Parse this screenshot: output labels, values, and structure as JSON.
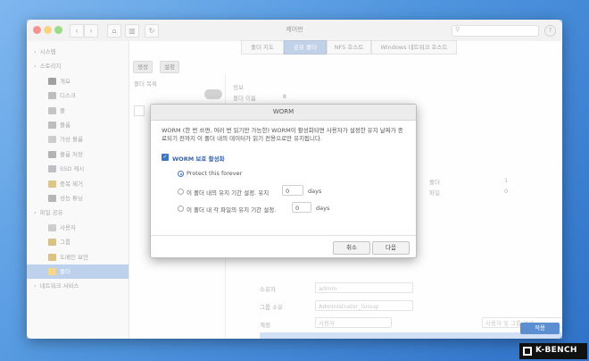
{
  "window": {
    "title": "제어판"
  },
  "tabs": [
    {
      "label": "폴더 지도"
    },
    {
      "label": "공유 폴더"
    },
    {
      "label": "NFS 호스트"
    },
    {
      "label": "Windows 네트워크 호스트"
    }
  ],
  "sidebar": {
    "items": [
      {
        "label": "시스템",
        "level": 0
      },
      {
        "label": "스토리지",
        "level": 0
      },
      {
        "label": "개요",
        "level": 1
      },
      {
        "label": "디스크",
        "level": 1
      },
      {
        "label": "풀",
        "level": 1
      },
      {
        "label": "볼륨",
        "level": 1
      },
      {
        "label": "가상 볼륨",
        "level": 1
      },
      {
        "label": "볼륨 저장",
        "level": 1
      },
      {
        "label": "SSD 캐시",
        "level": 1
      },
      {
        "label": "중복 제거",
        "level": 1
      },
      {
        "label": "성능 튜닝",
        "level": 1
      },
      {
        "label": "파일 공유",
        "level": 0
      },
      {
        "label": "사용자",
        "level": 1
      },
      {
        "label": "그룹",
        "level": 1
      },
      {
        "label": "도메인 보안",
        "level": 1
      },
      {
        "label": "폴더",
        "level": 1,
        "selected": true
      },
      {
        "label": "네트워크 서비스",
        "level": 0
      }
    ]
  },
  "toolbar": {
    "create": "생성",
    "settings": "설정"
  },
  "folder_list": {
    "title": "폴더 목록"
  },
  "info": {
    "title": "정보",
    "folder_name_label": "폴더 이름",
    "folder_name_value": "II"
  },
  "summary": {
    "folder_label": "폴더",
    "folder_count": "1",
    "file_label": "파일",
    "file_count": "0"
  },
  "permissions": {
    "owner_label": "소유자",
    "owner_value": "admin",
    "group_label": "그룹 소유",
    "group_value": "Administrator_Group",
    "account_label": "계정",
    "account_value": "사용자",
    "search_placeholder": "사용자 및 그룹 검색"
  },
  "dialog": {
    "title": "WORM",
    "description": "WORM (한 번 쓰면, 여러 번 읽기만 가능한) WORM이 활성화되면 사용자가 설정한 유지 날짜가 종료되기 전까지 이 폴더 내의 데이터가 읽기 전용으로만 유지됩니다.",
    "enable_label": "WORM 보호 활성화",
    "options": [
      {
        "label": "Protect this forever",
        "selected": true
      },
      {
        "label": "이 폴더 내의 유지 기간 설정. 유지",
        "value": "0",
        "unit": "days"
      },
      {
        "label": "이 폴더 내 각 파일의 유지 기간 설정.",
        "value": "0",
        "unit": "days"
      }
    ],
    "cancel": "취소",
    "next": "다음"
  },
  "footer": {
    "apply": "적용"
  },
  "brand": {
    "name": "K-BENCH"
  }
}
